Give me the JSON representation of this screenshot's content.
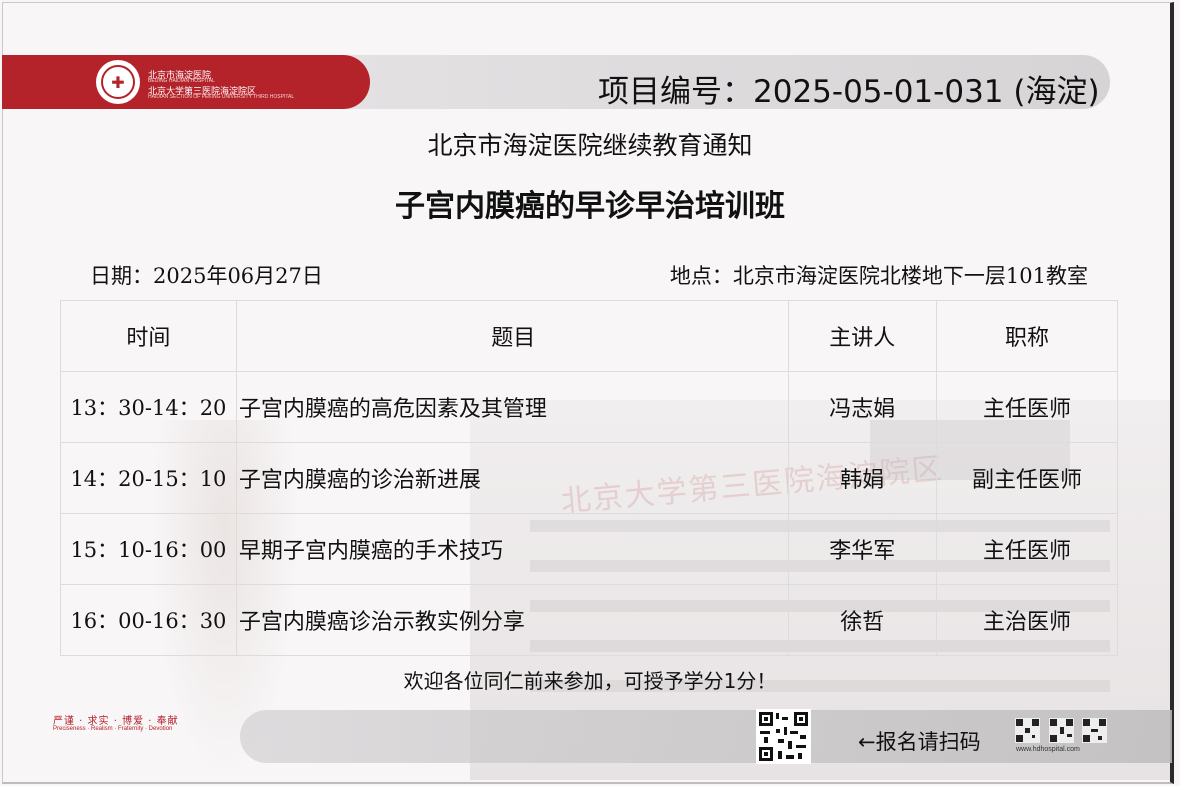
{
  "header": {
    "hospital_name_cn": "北京市海淀医院",
    "hospital_name_en": "BEIJING HAIDIAN HOSPITAL",
    "hospital_sub_cn": "北京大学第三医院海淀院区",
    "hospital_sub_en": "HAIDIAN SECTION OF PEKING UNIVERSITY THIRD HOSPITAL",
    "project_number": "项目编号：2025-05-01-031 (海淀)"
  },
  "notice_title": "北京市海淀医院继续教育通知",
  "course_title": "子宫内膜癌的早诊早治培训班",
  "date_line": "日期：2025年06月27日",
  "location_line": "地点：北京市海淀医院北楼地下一层101教室",
  "table": {
    "headers": [
      "时间",
      "题目",
      "主讲人",
      "职称"
    ],
    "rows": [
      {
        "time": "13：30-14：20",
        "topic": "子宫内膜癌的高危因素及其管理",
        "speaker": "冯志娟",
        "title": "主任医师"
      },
      {
        "time": "14：20-15：10",
        "topic": "子宫内膜癌的诊治新进展",
        "speaker": "韩娟",
        "title": "副主任医师"
      },
      {
        "time": "15：10-16：00",
        "topic": "早期子宫内膜癌的手术技巧",
        "speaker": "李华军",
        "title": "主任医师"
      },
      {
        "time": "16：00-16：30",
        "topic": "子宫内膜癌诊治示教实例分享",
        "speaker": "徐哲",
        "title": "主治医师"
      }
    ]
  },
  "welcome": "欢迎各位同仁前来参加，可授予学分1分！",
  "footer": {
    "motto_cn": "严谨 · 求实 · 博爱 · 奉献",
    "motto_en": "Preciseness · Realism · Fraternity · Devotion",
    "signup": "←报名请扫码",
    "site_url": "www.hdhospital.com"
  },
  "watermark_text": "北京大学第三医院海淀院区",
  "colors": {
    "brand_red": "#b4222a"
  }
}
